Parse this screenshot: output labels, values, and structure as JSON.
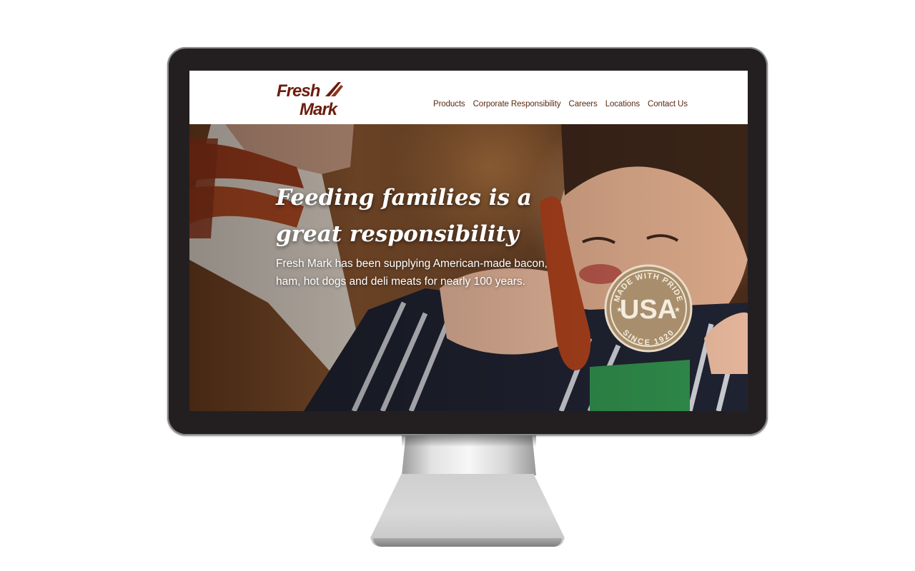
{
  "site": {
    "logo_text": [
      "Fresh",
      "Mark"
    ],
    "nav": [
      {
        "label": "Products"
      },
      {
        "label": "Corporate Responsibility"
      },
      {
        "label": "Careers"
      },
      {
        "label": "Locations"
      },
      {
        "label": "Contact Us"
      }
    ],
    "hero": {
      "title": "Feeding families is a great responsibility",
      "subtitle": "Fresh Mark has been supplying American-made bacon, ham, hot dogs and deli meats for nearly 100 years.",
      "badge": {
        "top_text": "MADE WITH PRIDE",
        "main_text": "USA",
        "bottom_text": "SINCE 1920"
      }
    }
  },
  "colors": {
    "brand": "#6b1d0e",
    "nav_text": "#5a2a12",
    "bezel": "#231f20",
    "badge": "#a88e6c"
  }
}
